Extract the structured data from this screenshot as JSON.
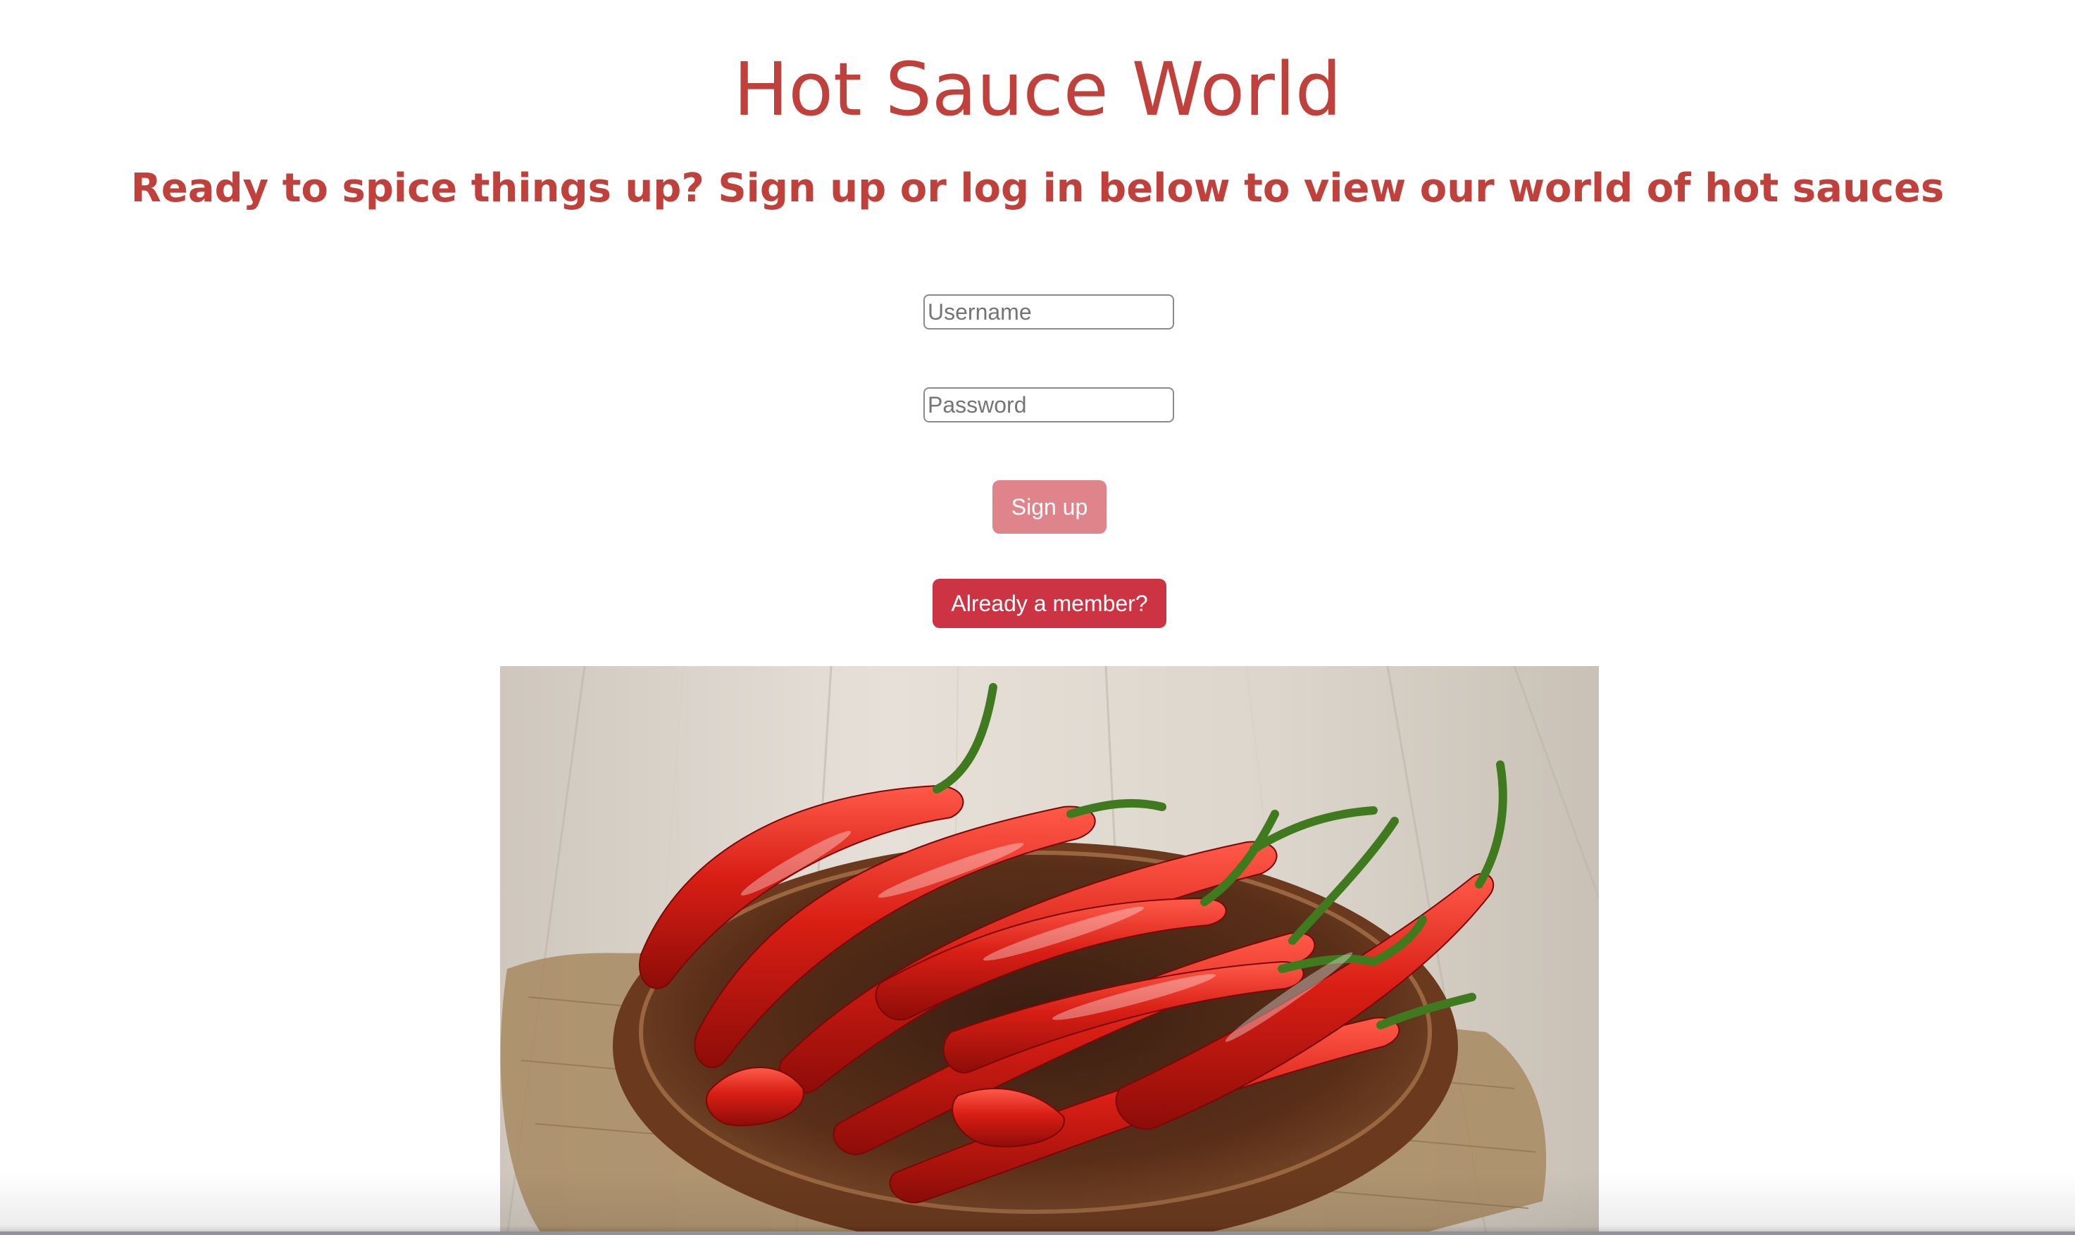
{
  "header": {
    "title": "Hot Sauce World",
    "tagline": "Ready to spice things up? Sign up or log in below to view our world of hot sauces"
  },
  "form": {
    "username_placeholder": "Username",
    "username_value": "",
    "password_placeholder": "Password",
    "password_value": "",
    "signup_label": "Sign up",
    "member_label": "Already a member?"
  },
  "image": {
    "icon": "chili-peppers-photo"
  },
  "colors": {
    "heading": "#c0413b",
    "signup_button": "#e0848c",
    "member_button": "#cc3443"
  }
}
